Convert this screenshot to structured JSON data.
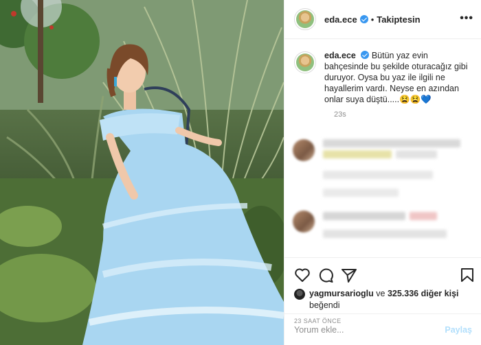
{
  "header": {
    "username": "eda.ece",
    "separator": "•",
    "follow_status": "Takiptesin",
    "more_icon": "more-horizontal-icon"
  },
  "caption": {
    "username": "eda.ece",
    "text": "Bütün yaz evin bahçesinde bu şekilde oturacağız gibi duruyor. Oysa bu yaz ile ilgili ne hayallerim vardı. Neyse en azından onlar suya düştü.....😫😫💙",
    "time": "23s"
  },
  "actions": {
    "icons": [
      "heart-icon",
      "comment-icon",
      "share-icon",
      "bookmark-icon"
    ]
  },
  "likes": {
    "user": "yagmursarioglu",
    "connector": "ve",
    "count_text": "325.336 diğer kişi",
    "suffix": "beğendi"
  },
  "time_ago": "23 SAAT ÖNCE",
  "comment_box": {
    "placeholder": "Yorum ekle...",
    "post_label": "Paylaş"
  },
  "colors": {
    "verified": "#3897f0",
    "dress": "#a9d6f1",
    "post_disabled": "#b2dffc"
  }
}
